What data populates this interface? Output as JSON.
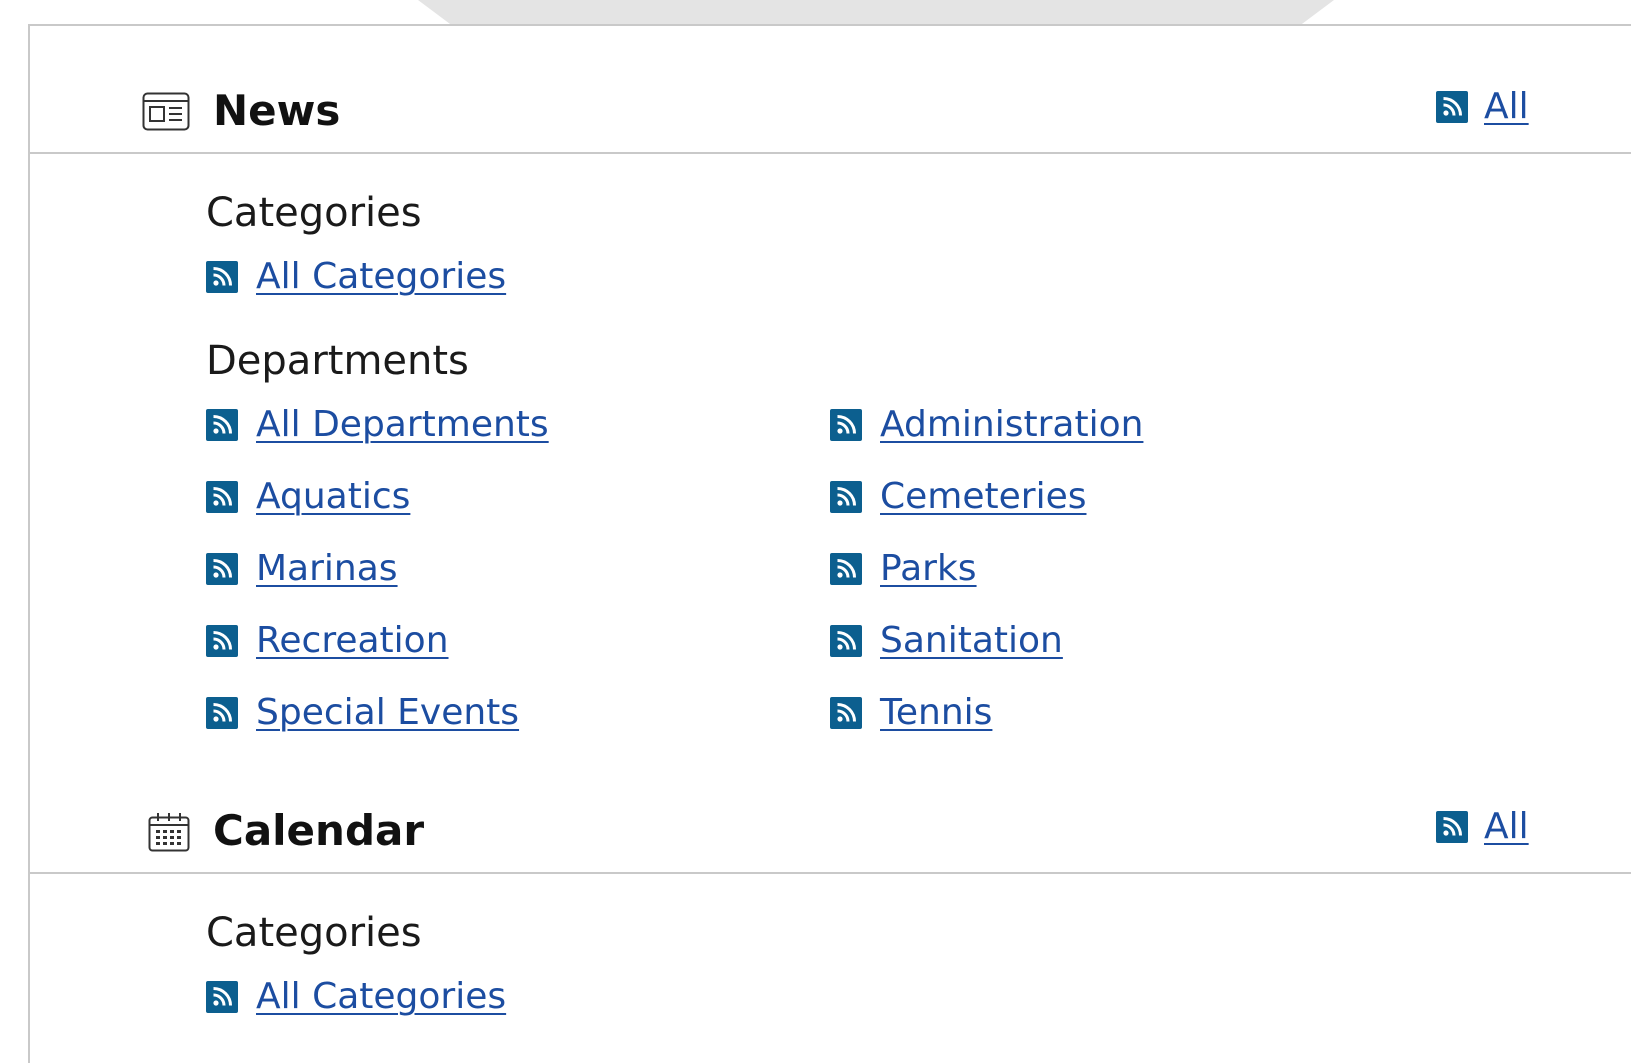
{
  "sections": [
    {
      "title": "News",
      "icon": "newspaper-icon",
      "all_label": "All",
      "groups": [
        {
          "label": "Categories",
          "items": [
            "All Categories"
          ]
        },
        {
          "label": "Departments",
          "items": [
            "All Departments",
            "Administration",
            "Aquatics",
            "Cemeteries",
            "Marinas",
            "Parks",
            "Recreation",
            "Sanitation",
            "Special Events",
            "Tennis"
          ]
        }
      ]
    },
    {
      "title": "Calendar",
      "icon": "calendar-icon",
      "all_label": "All",
      "groups": [
        {
          "label": "Categories",
          "items": [
            "All Categories"
          ]
        }
      ]
    }
  ],
  "colors": {
    "rss_badge": "#0c5f8f",
    "link": "#1c4da1",
    "divider": "#c9c9c9",
    "tab": "#e4e4e4"
  }
}
